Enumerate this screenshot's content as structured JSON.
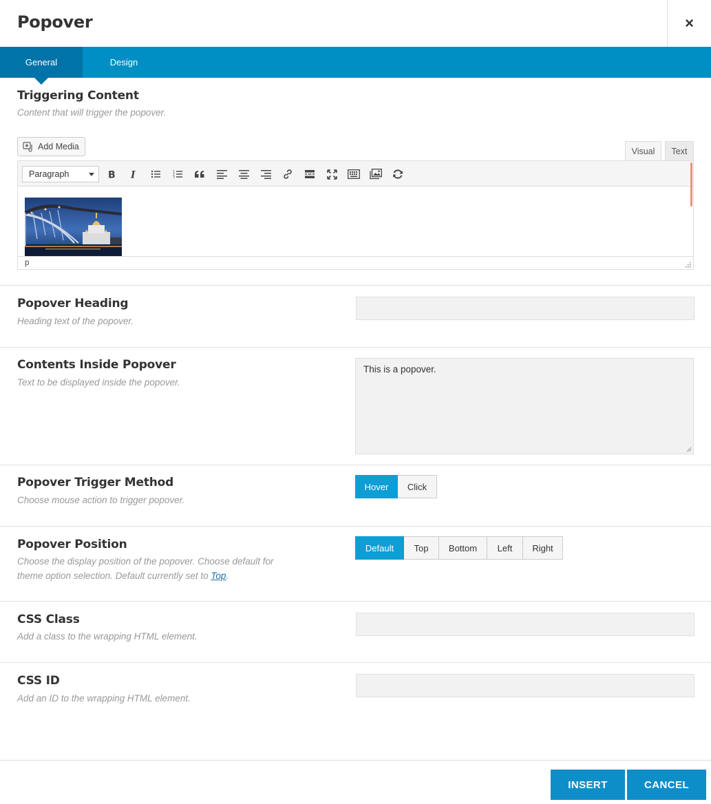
{
  "dialog": {
    "title": "Popover",
    "close_label": "×"
  },
  "tabs": [
    {
      "label": "General",
      "active": true
    },
    {
      "label": "Design",
      "active": false
    }
  ],
  "triggering": {
    "title": "Triggering Content",
    "desc": "Content that will trigger the popover.",
    "add_media_label": "Add Media",
    "mode_visual": "Visual",
    "mode_text": "Text",
    "format_select": "Paragraph",
    "status_path": "p"
  },
  "heading": {
    "title": "Popover Heading",
    "desc": "Heading text of the popover.",
    "value": ""
  },
  "contents": {
    "title": "Contents Inside Popover",
    "desc": "Text to be displayed inside the popover.",
    "value": "This is a popover."
  },
  "trigger_method": {
    "title": "Popover Trigger Method",
    "desc": "Choose mouse action to trigger popover.",
    "options": [
      "Hover",
      "Click"
    ],
    "selected": "Hover"
  },
  "position": {
    "title": "Popover Position",
    "desc_line1": "Choose the display position of the popover. Choose default for",
    "desc_line2": "theme option selection. Default currently set to ",
    "desc_link": "Top",
    "desc_end": ".",
    "options": [
      "Default",
      "Top",
      "Bottom",
      "Left",
      "Right"
    ],
    "selected": "Default"
  },
  "css_class": {
    "title": "CSS Class",
    "desc": "Add a class to the wrapping HTML element.",
    "value": ""
  },
  "css_id": {
    "title": "CSS ID",
    "desc": "Add an ID to the wrapping HTML element.",
    "value": ""
  },
  "footer": {
    "insert_label": "INSERT",
    "cancel_label": "CANCEL"
  },
  "colors": {
    "accent": "#008fc5",
    "accent_dark": "#0073a8",
    "active_button": "#0e9ed6"
  },
  "icons": {
    "toolbar": [
      "bold-icon",
      "italic-icon",
      "bullet-list-icon",
      "numbered-list-icon",
      "blockquote-icon",
      "align-left-icon",
      "align-center-icon",
      "align-right-icon",
      "link-icon",
      "read-more-icon",
      "fullscreen-icon",
      "toolbar-toggle-icon",
      "insert-image-icon",
      "refresh-icon"
    ]
  }
}
